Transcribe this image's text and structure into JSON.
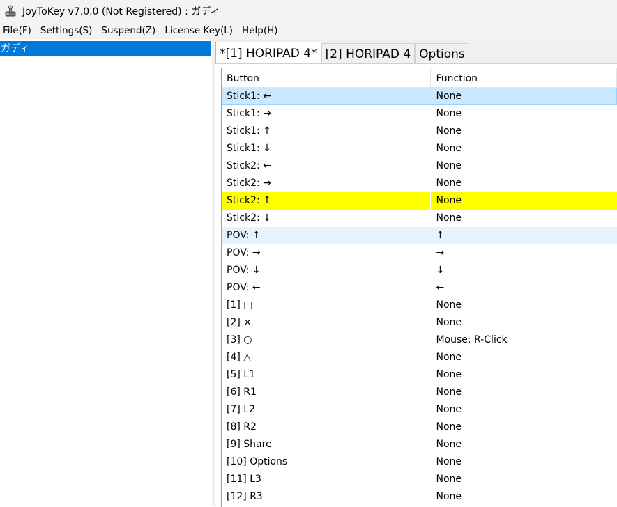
{
  "window": {
    "title": "JoyToKey v7.0.0 (Not Registered) : ガディ",
    "icon": "joystick-icon"
  },
  "menu": [
    {
      "label": "File(F)"
    },
    {
      "label": "Settings(S)"
    },
    {
      "label": "Suspend(Z)"
    },
    {
      "label": "License Key(L)"
    },
    {
      "label": "Help(H)"
    }
  ],
  "profiles": [
    {
      "label": "ガディ",
      "selected": true
    }
  ],
  "tabs": [
    {
      "label": "*[1] HORIPAD 4*",
      "active": true
    },
    {
      "label": "[2] HORIPAD 4",
      "active": false
    },
    {
      "label": "Options",
      "active": false
    }
  ],
  "table": {
    "headers": {
      "button": "Button",
      "function": "Function"
    },
    "rows": [
      {
        "button": "Stick1: ←",
        "function": "None",
        "state": "selected"
      },
      {
        "button": "Stick1: →",
        "function": "None",
        "state": ""
      },
      {
        "button": "Stick1: ↑",
        "function": "None",
        "state": ""
      },
      {
        "button": "Stick1: ↓",
        "function": "None",
        "state": ""
      },
      {
        "button": "Stick2: ←",
        "function": "None",
        "state": ""
      },
      {
        "button": "Stick2: →",
        "function": "None",
        "state": ""
      },
      {
        "button": "Stick2: ↑",
        "function": "None",
        "state": "highlight"
      },
      {
        "button": "Stick2: ↓",
        "function": "None",
        "state": ""
      },
      {
        "button": "POV: ↑",
        "function": "↑",
        "state": "hover"
      },
      {
        "button": "POV: →",
        "function": "→",
        "state": ""
      },
      {
        "button": "POV: ↓",
        "function": "↓",
        "state": ""
      },
      {
        "button": "POV: ←",
        "function": "←",
        "state": ""
      },
      {
        "button": "[1] □",
        "function": "None",
        "state": ""
      },
      {
        "button": "[2] ×",
        "function": "None",
        "state": ""
      },
      {
        "button": "[3] ○",
        "function": "Mouse: R-Click",
        "state": ""
      },
      {
        "button": "[4] △",
        "function": "None",
        "state": ""
      },
      {
        "button": "[5] L1",
        "function": "None",
        "state": ""
      },
      {
        "button": "[6] R1",
        "function": "None",
        "state": ""
      },
      {
        "button": "[7] L2",
        "function": "None",
        "state": ""
      },
      {
        "button": "[8] R2",
        "function": "None",
        "state": ""
      },
      {
        "button": "[9] Share",
        "function": "None",
        "state": ""
      },
      {
        "button": "[10] Options",
        "function": "None",
        "state": ""
      },
      {
        "button": "[11] L3",
        "function": "None",
        "state": ""
      },
      {
        "button": "[12] R3",
        "function": "None",
        "state": ""
      }
    ]
  },
  "colors": {
    "selection_blue": "#0078d7",
    "row_selected": "#cce8ff",
    "row_highlight": "#ffff00",
    "row_hover": "#e5f3ff"
  }
}
